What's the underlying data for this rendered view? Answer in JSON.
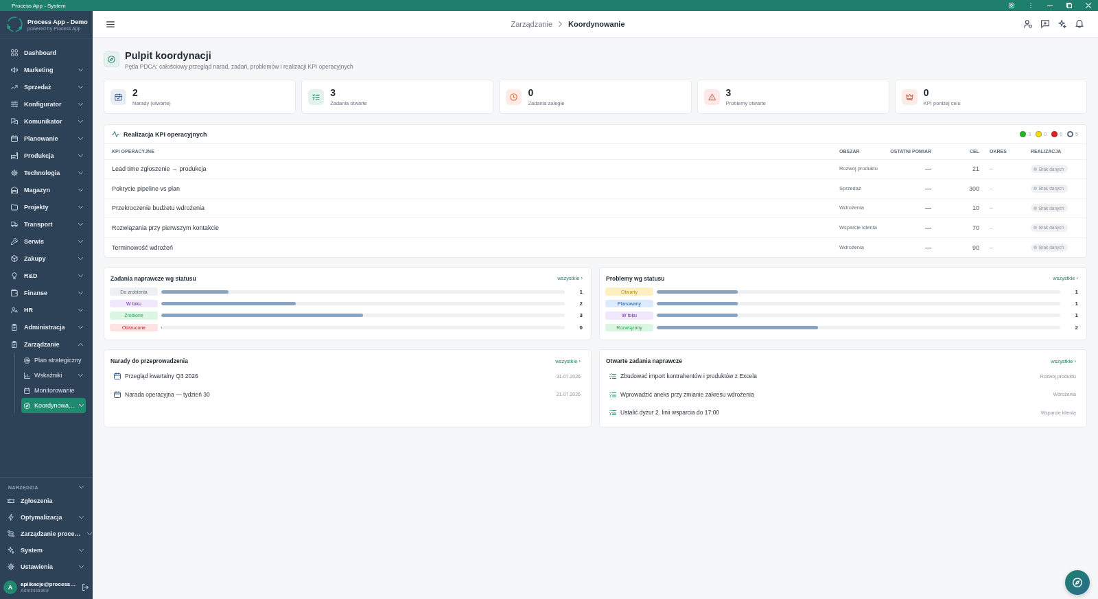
{
  "window": {
    "title": "Process App - System"
  },
  "sidebar": {
    "brand": {
      "name": "Process App - Demo",
      "tagline": "powered by Process App"
    },
    "items": [
      {
        "label": "Dashboard",
        "kind": "link",
        "selected": false
      },
      {
        "label": "Marketing",
        "kind": "group",
        "expanded": false,
        "selected": false
      },
      {
        "label": "Sprzedaż",
        "kind": "group",
        "expanded": false,
        "selected": false
      },
      {
        "label": "Konfigurator",
        "kind": "group",
        "expanded": false,
        "selected": false
      },
      {
        "label": "Komunikator",
        "kind": "group",
        "expanded": false,
        "selected": false
      },
      {
        "label": "Planowanie",
        "kind": "group",
        "expanded": false,
        "selected": false
      },
      {
        "label": "Produkcja",
        "kind": "group",
        "expanded": false,
        "selected": false
      },
      {
        "label": "Technologia",
        "kind": "group",
        "expanded": false,
        "selected": false
      },
      {
        "label": "Magazyn",
        "kind": "group",
        "expanded": false,
        "selected": false
      },
      {
        "label": "Projekty",
        "kind": "group",
        "expanded": false,
        "selected": false
      },
      {
        "label": "Transport",
        "kind": "group",
        "expanded": false,
        "selected": false
      },
      {
        "label": "Serwis",
        "kind": "group",
        "expanded": false,
        "selected": false
      },
      {
        "label": "Zakupy",
        "kind": "group",
        "expanded": false,
        "selected": false
      },
      {
        "label": "R&D",
        "kind": "group",
        "expanded": false,
        "selected": false
      },
      {
        "label": "Finanse",
        "kind": "group",
        "expanded": false,
        "selected": false
      },
      {
        "label": "HR",
        "kind": "group",
        "expanded": false,
        "selected": false
      },
      {
        "label": "Administracja",
        "kind": "group",
        "expanded": false,
        "selected": false
      },
      {
        "label": "Zarządzanie",
        "kind": "group",
        "expanded": true,
        "selected": false,
        "children": [
          {
            "label": "Plan strategiczny",
            "kind": "link",
            "selected": false
          },
          {
            "label": "Wskaźniki",
            "kind": "group",
            "expanded": false,
            "selected": false
          },
          {
            "label": "Monitorowanie",
            "kind": "link",
            "selected": false
          },
          {
            "label": "Koordynowa…",
            "kind": "group",
            "expanded": false,
            "selected": true
          }
        ]
      }
    ],
    "tools": {
      "title": "NARZĘDZIA",
      "items": [
        {
          "label": "Zgłoszenia",
          "kind": "link",
          "selected": false
        },
        {
          "label": "Optymalizacja",
          "kind": "group",
          "expanded": false,
          "selected": false
        },
        {
          "label": "Zarządzanie proce…",
          "kind": "group",
          "expanded": false,
          "selected": false
        },
        {
          "label": "System",
          "kind": "group",
          "expanded": false,
          "selected": false
        },
        {
          "label": "Ustawienia",
          "kind": "group",
          "expanded": false,
          "selected": false
        }
      ]
    },
    "user": {
      "initial": "A",
      "name": "aplikacje@process…",
      "role": "Administrator"
    }
  },
  "header": {
    "breadcrumb": [
      {
        "label": "Zarządzanie",
        "current": false
      },
      {
        "label": "Koordynowanie",
        "current": true
      }
    ]
  },
  "page": {
    "title": "Pulpit koordynacji",
    "subtitle": "Pętla PDCA: całościowy przegląd narad, zadań, problemów i realizacji KPI operacyjnych"
  },
  "stats": [
    {
      "value": "2",
      "label": "Narady (otwarte)"
    },
    {
      "value": "3",
      "label": "Zadania otwarte"
    },
    {
      "value": "0",
      "label": "Zadania zaległe"
    },
    {
      "value": "3",
      "label": "Problemy otwarte"
    },
    {
      "value": "0",
      "label": "KPI poniżej celu"
    }
  ],
  "kpi_table": {
    "title": "Realizacja KPI operacyjnych",
    "legend": [
      {
        "kind": "filled",
        "color": "#22b422",
        "count": "0"
      },
      {
        "kind": "filled",
        "color": "#f2dc12",
        "count": "0"
      },
      {
        "kind": "filled",
        "color": "#e02424",
        "count": "0"
      },
      {
        "kind": "hollow",
        "color": "#5f6b78",
        "count": "5"
      }
    ],
    "columns": [
      "KPI OPERACYJNE",
      "OBSZAR",
      "OSTATNI POMIAR",
      "CEL",
      "OKRES",
      "REALIZACJA"
    ],
    "rows": [
      {
        "kpi": "Lead time zgłoszenie → produkcja",
        "area": "Rozwój produktu",
        "last_measurement": "—",
        "target": "21",
        "period": "–",
        "status": "Brak danych"
      },
      {
        "kpi": "Pokrycie pipeline vs plan",
        "area": "Sprzedaż",
        "last_measurement": "—",
        "target": "300",
        "period": "–",
        "status": "Brak danych"
      },
      {
        "kpi": "Przekroczenie budżetu wdrożenia",
        "area": "Wdrożenia",
        "last_measurement": "—",
        "target": "10",
        "period": "–",
        "status": "Brak danych"
      },
      {
        "kpi": "Rozwiązania przy pierwszym kontakcie",
        "area": "Wsparcie klienta",
        "last_measurement": "—",
        "target": "70",
        "period": "–",
        "status": "Brak danych"
      },
      {
        "kpi": "Terminowość wdrożeń",
        "area": "Wdrożenia",
        "last_measurement": "—",
        "target": "90",
        "period": "–",
        "status": "Brak danych"
      }
    ]
  },
  "tasks_by_status": {
    "title": "Zadania naprawcze wg statusu",
    "link": "wszystkie ›",
    "rows": [
      {
        "label": "Do zrobienia",
        "color": "#eef0f2",
        "level": 0.167,
        "count": "1"
      },
      {
        "label": "W toku",
        "color": "#f1e8fd",
        "level": 0.333,
        "count": "2"
      },
      {
        "label": "Zrobione",
        "color": "#dcf6e4",
        "level": 0.5,
        "count": "3"
      },
      {
        "label": "Odrzucone",
        "color": "#fde3e3",
        "level": 0,
        "count": "0"
      }
    ]
  },
  "problems_by_status": {
    "title": "Problemy wg statusu",
    "link": "wszystkie ›",
    "rows": [
      {
        "label": "Otwarty",
        "color": "#fdf0c3",
        "level": 0.2,
        "count": "1"
      },
      {
        "label": "Planowany",
        "color": "#dceafe",
        "level": 0.2,
        "count": "1"
      },
      {
        "label": "W toku",
        "color": "#f1e8fd",
        "level": 0.2,
        "count": "1"
      },
      {
        "label": "Rozwiązany",
        "color": "#dcf6e4",
        "level": 0.4,
        "count": "2"
      }
    ]
  },
  "meetings": {
    "title": "Narady do przeprowadzenia",
    "link": "wszystkie ›",
    "items": [
      {
        "title": "Przegląd kwartalny Q3 2026",
        "date": "31.07.2026"
      },
      {
        "title": "Narada operacyjna — tydzień 30",
        "date": "21.07.2026"
      }
    ]
  },
  "open_tasks": {
    "title": "Otwarte zadania naprawcze",
    "link": "wszystkie ›",
    "items": [
      {
        "title": "Zbudować import kontrahentów i produktów z Excela",
        "area": "Rozwój produktu"
      },
      {
        "title": "Wprowadzić aneks przy zmianie zakresu wdrożenia",
        "area": "Wdrożenia"
      },
      {
        "title": "Ustalić dyżur 2. linii wsparcia do 17:00",
        "area": "Wsparcie klienta"
      }
    ]
  }
}
